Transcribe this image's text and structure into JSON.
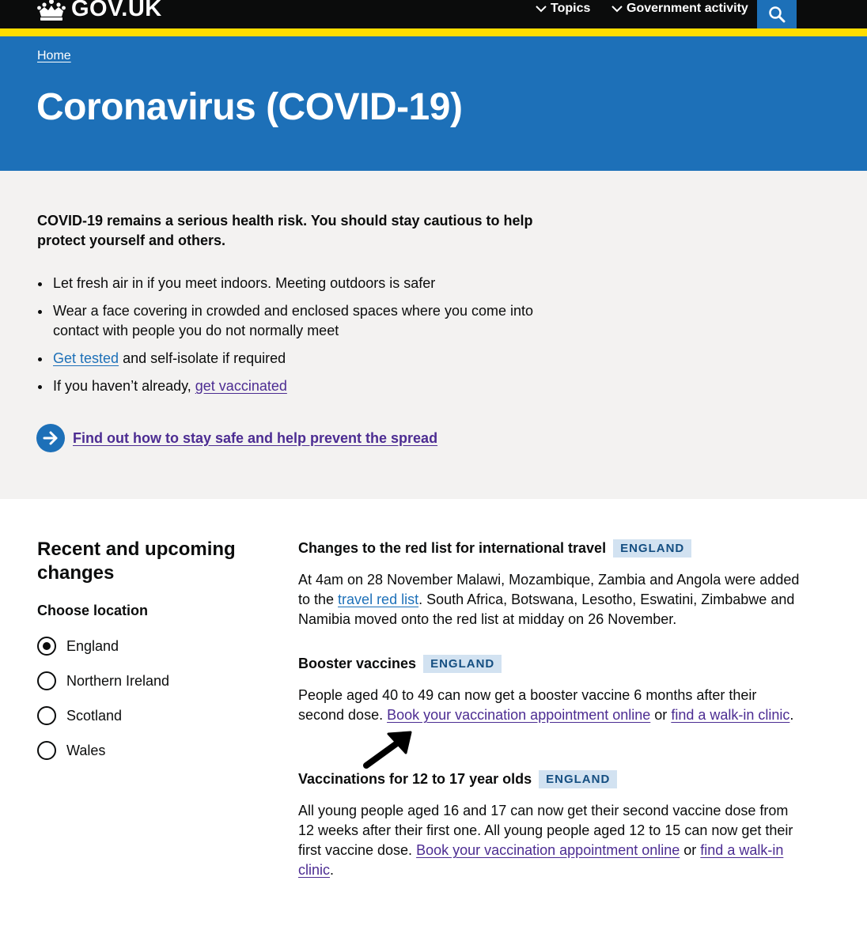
{
  "header": {
    "logo_text": "GOV.UK",
    "nav": [
      {
        "label": "Topics"
      },
      {
        "label": "Government activity"
      }
    ],
    "search_icon": "search-icon"
  },
  "hero": {
    "breadcrumb": "Home",
    "title": "Coronavirus (COVID-19)"
  },
  "notice": {
    "lead": "COVID-19 remains a serious health risk. You should stay cautious to help protect yourself and others.",
    "bullets": {
      "b1": "Let fresh air in if you meet indoors. Meeting outdoors is safer",
      "b2": "Wear a face covering in crowded and enclosed spaces where you come into contact with people you do not normally meet",
      "b3_link": "Get tested",
      "b3_rest": " and self-isolate if required",
      "b4_pre": "If you haven’t already, ",
      "b4_link": "get vaccinated"
    },
    "cta": "Find out how to stay safe and help prevent the spread"
  },
  "sidebar": {
    "heading": "Recent and upcoming changes",
    "choose_label": "Choose location",
    "options": [
      {
        "label": "England",
        "checked": true
      },
      {
        "label": "Northern Ireland",
        "checked": false
      },
      {
        "label": "Scotland",
        "checked": false
      },
      {
        "label": "Wales",
        "checked": false
      }
    ]
  },
  "changes": [
    {
      "title": "Changes to the red list for international travel",
      "tag": "ENGLAND",
      "text_pre": "At 4am on 28 November Malawi, Mozambique, Zambia and Angola were added to the ",
      "link1": "travel red list",
      "text_post": ". South Africa, Botswana, Lesotho, Eswatini, Zimbabwe and Namibia moved onto the red list at midday on 26 November."
    },
    {
      "title": "Booster vaccines",
      "tag": "ENGLAND",
      "text_pre": "People aged 40 to 49 can now get a booster vaccine 6 months after their second dose. ",
      "link1": "Book your vaccination appointment online",
      "text_mid": " or ",
      "link2": "find a walk-in clinic",
      "text_post": "."
    },
    {
      "title": "Vaccinations for 12 to 17 year olds",
      "tag": "ENGLAND",
      "text_pre": "All young people aged 16 and 17 can now get their second vaccine dose from 12 weeks after their first one. All young people aged 12 to 15 can now get their first vaccine dose. ",
      "link1": "Book your vaccination appointment online",
      "text_mid": " or ",
      "link2": "find a walk-in clinic",
      "text_post": "."
    }
  ],
  "colors": {
    "header_bg": "#0b0c0c",
    "brand_blue": "#1d70b8",
    "yellow_stripe": "#ffdd00",
    "notice_bg": "#f3f2f1",
    "visited_link": "#4c2c92",
    "tag_bg": "#d2e2f1",
    "tag_text": "#144e81"
  }
}
